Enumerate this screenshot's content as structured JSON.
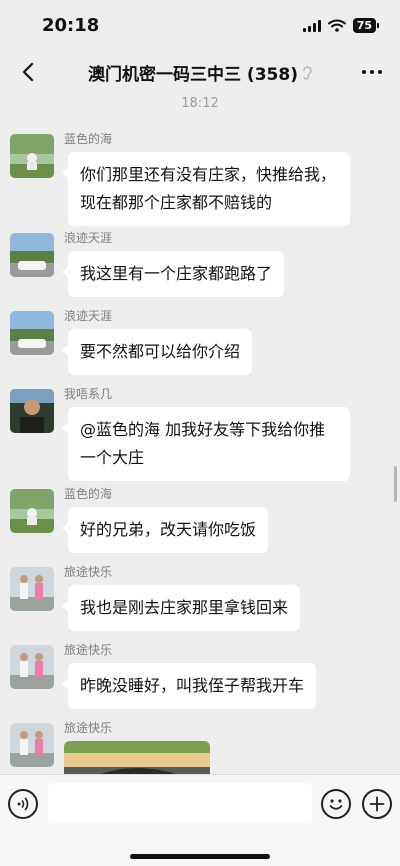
{
  "status": {
    "time": "20:18",
    "battery": "75"
  },
  "nav": {
    "title": "澳门机密一码三中三 (358)"
  },
  "chat": {
    "time_divider": "18:12",
    "messages": [
      {
        "sender": "蓝色的海",
        "text": "你们那里还有没有庄家，快推给我，现在都那个庄家都不赔钱的",
        "avatar": "landscape-avatar"
      },
      {
        "sender": "浪迹天涯",
        "text": "我这里有一个庄家都跑路了",
        "avatar": "car-avatar"
      },
      {
        "sender": "浪迹天涯",
        "text": "要不然都可以给你介绍",
        "avatar": "car-avatar"
      },
      {
        "sender": "我唔系几",
        "text": "@蓝色的海 加我好友等下我给你推一个大庄",
        "avatar": "person-avatar"
      },
      {
        "sender": "蓝色的海",
        "text": "好的兄弟，改天请你吃饭",
        "avatar": "landscape-avatar"
      },
      {
        "sender": "旅途快乐",
        "text": "我也是刚去庄家那里拿钱回来",
        "avatar": "kids-avatar"
      },
      {
        "sender": "旅途快乐",
        "text": "昨晚没睡好，叫我侄子帮我开车",
        "avatar": "kids-avatar"
      },
      {
        "sender": "旅途快乐",
        "text": "",
        "avatar": "kids-avatar",
        "image": "car-photo"
      }
    ]
  },
  "input": {
    "value": "",
    "placeholder": ""
  },
  "icons": {
    "back": "chevron-left-icon",
    "mute": "ear-icon",
    "more": "more-dots-icon",
    "voice": "voice-icon",
    "emoji": "emoji-icon",
    "plus": "plus-icon"
  },
  "colors": {
    "background": "#ededed",
    "bubble": "#ffffff",
    "sender": "#7f7f7f"
  }
}
